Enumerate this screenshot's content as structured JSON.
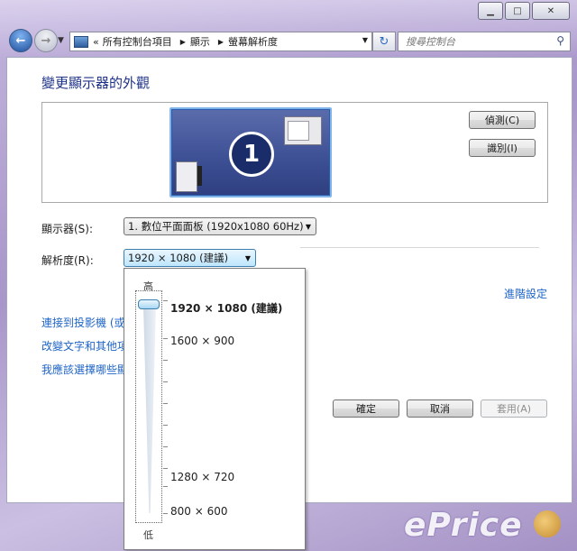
{
  "navbar": {
    "address_segments": [
      "«",
      "所有控制台項目",
      "顯示",
      "螢幕解析度"
    ],
    "search_placeholder": "搜尋控制台"
  },
  "page": {
    "title": "變更顯示器的外觀",
    "monitor_number": "1",
    "detect_button": "偵測(C)",
    "identify_button": "識別(I)",
    "display_label": "顯示器(S):",
    "display_value": "1. 數位平面面板 (1920x1080 60Hz)",
    "resolution_label": "解析度(R):",
    "resolution_value": "1920 × 1080 (建議)",
    "advanced_link": "進階設定",
    "links": [
      "連接到投影機 (或",
      "改變文字和其他項",
      "我應該選擇哪些顯"
    ],
    "ok_button": "確定",
    "cancel_button": "取消",
    "apply_button": "套用(A)"
  },
  "resolution_dropdown": {
    "high_label": "高",
    "low_label": "低",
    "options": [
      "1920 × 1080 (建議)",
      "1600 × 900",
      "1280 × 720",
      "800 × 600"
    ],
    "selected_index": 0
  },
  "watermark": "ePrice"
}
